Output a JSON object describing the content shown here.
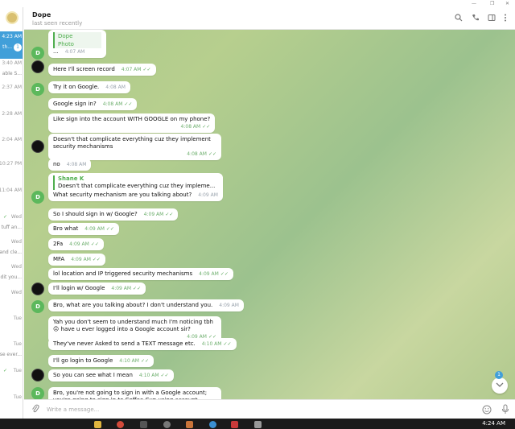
{
  "window": {
    "controls": [
      "—",
      "❐",
      "✕"
    ]
  },
  "sidebar": {
    "items": [
      {
        "time": "",
        "snippet": "",
        "active": false,
        "logo": true
      },
      {
        "time": "4:23 AM",
        "snippet": "th...",
        "active": true,
        "badge": "1"
      },
      {
        "time": "3:40 AM",
        "snippet": "able S...",
        "active": false
      },
      {
        "time": "2:37 AM",
        "snippet": "",
        "active": false
      },
      {
        "time": "2:28 AM",
        "snippet": "",
        "active": false
      },
      {
        "time": "2:04 AM",
        "snippet": "",
        "active": false
      },
      {
        "time": "10:27 PM",
        "snippet": "",
        "active": false
      },
      {
        "time": "11:04 AM",
        "snippet": "",
        "active": false
      },
      {
        "time": "Wed",
        "snippet": "tuff an...",
        "active": false,
        "check": true
      },
      {
        "time": "Wed",
        "snippet": "and cle...",
        "active": false
      },
      {
        "time": "Wed",
        "snippet": "dit you...",
        "active": false
      },
      {
        "time": "Wed",
        "snippet": "",
        "active": false
      },
      {
        "time": "Tue",
        "snippet": "",
        "active": false
      },
      {
        "time": "Tue",
        "snippet": "se ever...",
        "active": false
      },
      {
        "time": "Tue",
        "snippet": "",
        "active": false,
        "check": true
      },
      {
        "time": "Tue",
        "snippet": "",
        "active": false
      }
    ]
  },
  "header": {
    "name": "Dope",
    "status": "last seen recently",
    "icons": [
      "search-icon",
      "phone-icon",
      "sidebar-toggle-icon",
      "more-icon"
    ]
  },
  "messages": [
    {
      "photo_label": "Dope",
      "photo_sub": "Photo",
      "text": "...",
      "time": "4:07 AM",
      "avatar": "D",
      "avatar_type": "d",
      "ticks": false
    },
    {
      "text": "Here I'll screen record",
      "time": "4:07 AM",
      "avatar": "",
      "avatar_type": "k",
      "ticks": true
    },
    {
      "text": "Try it on Google.",
      "time": "4:08 AM",
      "avatar": "D",
      "avatar_type": "d",
      "ticks": false
    },
    {
      "text": "Google sign in?",
      "time": "4:08 AM",
      "ticks": true
    },
    {
      "text": "Like sign into the account WITH GOOGLE on my phone?",
      "time": "4:08 AM",
      "ticks": true,
      "block": true
    },
    {
      "text": "Doesn't that complicate everything cuz they implement security mechanisms",
      "time": "4:08 AM",
      "avatar": "",
      "avatar_type": "k",
      "ticks": true,
      "block": true
    },
    {
      "text": "no",
      "time": "4:08 AM",
      "ticks": false
    },
    {
      "quote_name": "Shane K",
      "quote_text": "Doesn't that complicate everything cuz they impleme...",
      "text": "What security mechanism are you talking about?",
      "time": "4:09 AM",
      "avatar": "D",
      "avatar_type": "d",
      "ticks": false
    },
    {
      "text": "So I should sign in w/ Google?",
      "time": "4:09 AM",
      "ticks": true
    },
    {
      "text": "Bro what",
      "time": "4:09 AM",
      "ticks": true
    },
    {
      "text": "2Fa",
      "time": "4:09 AM",
      "ticks": true
    },
    {
      "text": "MFA",
      "time": "4:09 AM",
      "ticks": true
    },
    {
      "text": "lol location and IP triggered security mechanisms",
      "time": "4:09 AM",
      "ticks": true
    },
    {
      "text": "I'll login w/ Google",
      "time": "4:09 AM",
      "avatar": "",
      "avatar_type": "k",
      "ticks": true
    },
    {
      "text": "Bro, what are you talking about? I don't understand you.",
      "time": "4:09 AM",
      "avatar": "D",
      "avatar_type": "d",
      "ticks": false
    },
    {
      "text": "Yah you don't seem to understand much I'm noticing tbh 😐 have u ever logged into a Google account sir?",
      "time": "4:09 AM",
      "ticks": true,
      "block": true
    },
    {
      "text": "They've never Asked to send a TEXT message etc.",
      "time": "4:10 AM",
      "ticks": true
    },
    {
      "text": "I'll go login to Google",
      "time": "4:10 AM",
      "ticks": true
    },
    {
      "text": "So you can see what I mean",
      "time": "4:10 AM",
      "avatar": "",
      "avatar_type": "k",
      "ticks": true
    },
    {
      "text": "Bro, you're not going to sign in with a Google account; you're going to sign in to Coffee Cup using account",
      "time": "",
      "avatar": "D",
      "avatar_type": "d",
      "ticks": false,
      "block": true
    }
  ],
  "scroll": {
    "badge": "1",
    "icon": "chevron-down-icon"
  },
  "composer": {
    "placeholder": "Write a message...",
    "icons": [
      "paperclip-icon",
      "emoji-icon",
      "microphone-icon"
    ]
  },
  "taskbar": {
    "clock": "4:24 AM"
  }
}
